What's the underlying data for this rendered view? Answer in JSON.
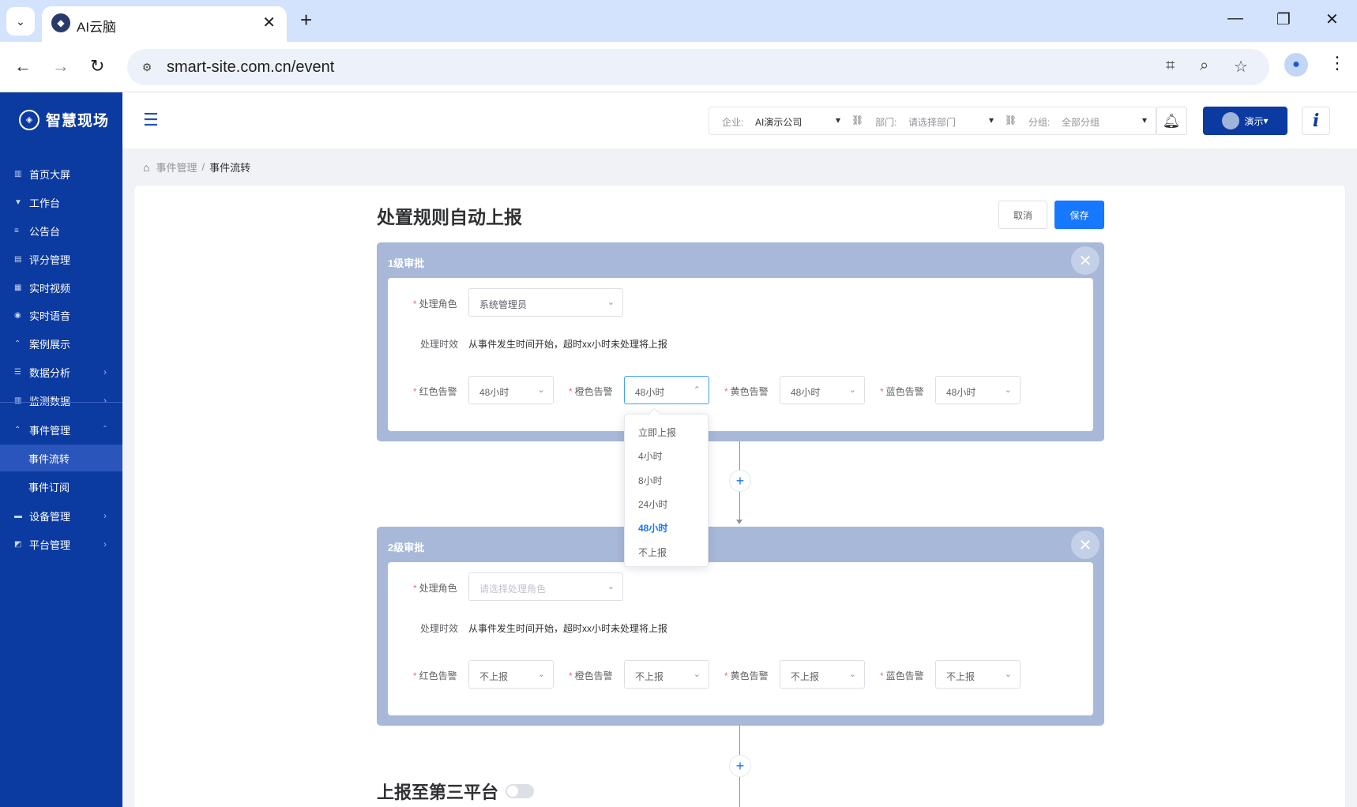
{
  "browser": {
    "tab_title": "AI云脑",
    "url": "smart-site.com.cn/event"
  },
  "brand": {
    "name": "智慧现场"
  },
  "sidebar": {
    "items": [
      {
        "label": "首页大屏",
        "icon": "dashboard-icon"
      },
      {
        "label": "工作台",
        "icon": "workbench-icon"
      },
      {
        "label": "公告台",
        "icon": "notice-icon"
      },
      {
        "label": "评分管理",
        "icon": "score-icon"
      },
      {
        "label": "实时视频",
        "icon": "video-icon"
      },
      {
        "label": "实时语音",
        "icon": "voice-icon"
      },
      {
        "label": "案例展示",
        "icon": "case-icon"
      },
      {
        "label": "数据分析",
        "icon": "analysis-icon"
      },
      {
        "label": "监测数据",
        "icon": "monitor-icon"
      },
      {
        "label": "事件管理",
        "icon": "event-icon"
      },
      {
        "label": "事件流转",
        "icon": ""
      },
      {
        "label": "事件订阅",
        "icon": ""
      },
      {
        "label": "设备管理",
        "icon": "device-icon"
      },
      {
        "label": "平台管理",
        "icon": "platform-icon"
      }
    ]
  },
  "header": {
    "company_label": "企业:",
    "company_value": "AI演示公司",
    "dept_label": "部门:",
    "dept_placeholder": "请选择部门",
    "group_label": "分组:",
    "group_value": "全部分组",
    "user_label": "演示"
  },
  "breadcrumb": {
    "parent": "事件管理",
    "sep": "/",
    "current": "事件流转"
  },
  "page": {
    "title": "处置规则自动上报",
    "cancel": "取消",
    "save": "保存"
  },
  "form_labels": {
    "role": "处理角色",
    "timeout": "处理时效",
    "timeout_desc": "从事件发生时间开始，超时xx小时未处理将上报",
    "red": "红色告警",
    "orange": "橙色告警",
    "yellow": "黄色告警",
    "blue": "蓝色告警",
    "required_mark": "*"
  },
  "levels": [
    {
      "title": "1级审批",
      "role": "系统管理员",
      "red": "48小时",
      "orange": "48小时",
      "yellow": "48小时",
      "blue": "48小时"
    },
    {
      "title": "2级审批",
      "role_placeholder": "请选择处理角色",
      "red": "不上报",
      "orange": "不上报",
      "yellow": "不上报",
      "blue": "不上报"
    }
  ],
  "dropdown": {
    "options": [
      "立即上报",
      "4小时",
      "8小时",
      "24小时",
      "48小时",
      "不上报"
    ],
    "selected": "48小时"
  },
  "third_platform": {
    "title": "上报至第三平台",
    "enabled": false
  },
  "colors": {
    "sidebar": "#0b3aa0",
    "primary": "#1677ff",
    "level_bg": "#a7b8d9"
  }
}
